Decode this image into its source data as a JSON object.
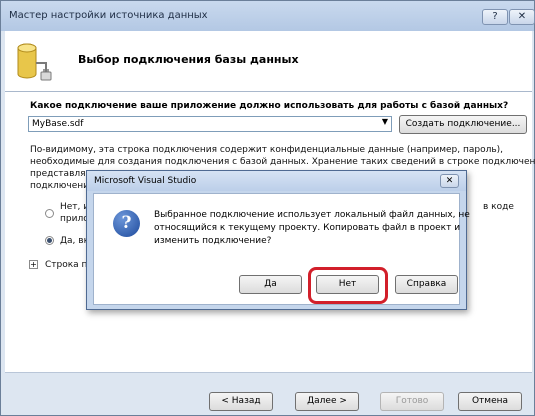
{
  "window": {
    "title": "Мастер настройки источника данных",
    "help_label": "?",
    "close_label": "✕"
  },
  "header": {
    "title": "Выбор подключения базы данных",
    "icon": "database-icon"
  },
  "body": {
    "question": "Какое подключение ваше приложение должно использовать для работы с базой данных?",
    "connection_value": "MyBase.sdf",
    "create_button": "Создать подключение...",
    "info_line1": "По-видимому, эта строка подключения содержит конфиденциальные данные (например, пароль),",
    "info_line2": "необходимые для создания подключения с базой данных. Хранение таких сведений в строке подключения",
    "info_line3": "представляет",
    "info_line4": "подключения",
    "option_no": "Нет, и",
    "option_no_line2": "прило",
    "option_no_tail": "в коде",
    "option_yes": "Да, вкл",
    "expander_label": "Строка п"
  },
  "footer": {
    "back": "< Назад",
    "next": "Далее >",
    "finish": "Готово",
    "cancel": "Отмена"
  },
  "dialog": {
    "title": "Microsoft Visual Studio",
    "close_label": "✕",
    "icon": "question-icon",
    "icon_glyph": "?",
    "message_line1": "Выбранное подключение использует локальный файл данных, не",
    "message_line2": "относящийся к текущему проекту. Копировать файл в проект и",
    "message_line3": "изменить подключение?",
    "yes": "Да",
    "no": "Нет",
    "help": "Справка"
  },
  "colors": {
    "highlight": "#d21f2a",
    "accent": "#1d4a9c"
  }
}
